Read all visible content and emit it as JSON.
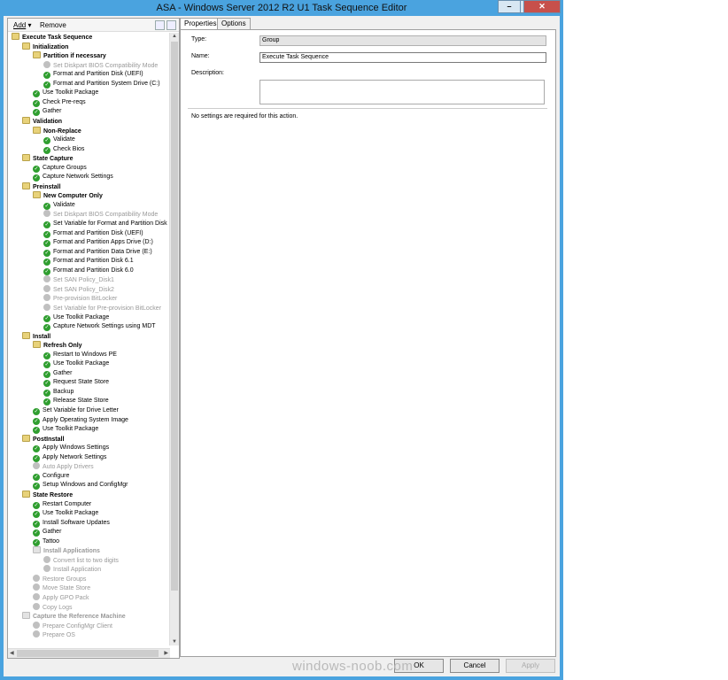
{
  "window": {
    "title": "ASA - Windows Server 2012 R2 U1 Task Sequence Editor",
    "minimize": "–",
    "maximize": "□",
    "close": "✕"
  },
  "toolbar": {
    "add": "Add",
    "remove": "Remove"
  },
  "tree": [
    {
      "label": "Execute Task Sequence",
      "lvl": 0,
      "icon": "folder",
      "bold": true
    },
    {
      "label": "Initialization",
      "lvl": 1,
      "icon": "folder",
      "bold": true
    },
    {
      "label": "Partition if necessary",
      "lvl": 2,
      "icon": "folder",
      "bold": true
    },
    {
      "label": "Set Diskpart BIOS Compatibility Mode",
      "lvl": 3,
      "icon": "disabled"
    },
    {
      "label": "Format and Partition Disk (UEFI)",
      "lvl": 3,
      "icon": "ok"
    },
    {
      "label": "Format and Partition System Drive (C:)",
      "lvl": 3,
      "icon": "ok"
    },
    {
      "label": "Use Toolkit Package",
      "lvl": 2,
      "icon": "ok"
    },
    {
      "label": "Check Pre-reqs",
      "lvl": 2,
      "icon": "ok"
    },
    {
      "label": "Gather",
      "lvl": 2,
      "icon": "ok"
    },
    {
      "label": "Validation",
      "lvl": 1,
      "icon": "folder",
      "bold": true
    },
    {
      "label": "Non-Replace",
      "lvl": 2,
      "icon": "folder",
      "bold": true
    },
    {
      "label": "Validate",
      "lvl": 3,
      "icon": "ok"
    },
    {
      "label": "Check Bios",
      "lvl": 3,
      "icon": "ok"
    },
    {
      "label": "State Capture",
      "lvl": 1,
      "icon": "folder",
      "bold": true
    },
    {
      "label": "Capture Groups",
      "lvl": 2,
      "icon": "ok"
    },
    {
      "label": "Capture Network Settings",
      "lvl": 2,
      "icon": "ok"
    },
    {
      "label": "Preinstall",
      "lvl": 1,
      "icon": "folder",
      "bold": true
    },
    {
      "label": "New Computer Only",
      "lvl": 2,
      "icon": "folder",
      "bold": true
    },
    {
      "label": "Validate",
      "lvl": 3,
      "icon": "ok"
    },
    {
      "label": "Set Diskpart BIOS Compatibility Mode",
      "lvl": 3,
      "icon": "disabled"
    },
    {
      "label": "Set Variable for Format and Partition Disk",
      "lvl": 3,
      "icon": "ok"
    },
    {
      "label": "Format and Partition Disk (UEFI)",
      "lvl": 3,
      "icon": "ok"
    },
    {
      "label": "Format and Partition Apps Drive (D:)",
      "lvl": 3,
      "icon": "ok"
    },
    {
      "label": "Format and Partition Data Drive (E:)",
      "lvl": 3,
      "icon": "ok"
    },
    {
      "label": "Format and Partition Disk 6.1",
      "lvl": 3,
      "icon": "ok"
    },
    {
      "label": "Format and Partition Disk 6.0",
      "lvl": 3,
      "icon": "ok"
    },
    {
      "label": "Set SAN Policy_Disk1",
      "lvl": 3,
      "icon": "disabled"
    },
    {
      "label": "Set SAN Policy_Disk2",
      "lvl": 3,
      "icon": "disabled"
    },
    {
      "label": "Pre-provision BitLocker",
      "lvl": 3,
      "icon": "disabled"
    },
    {
      "label": "Set Variable for Pre-provision BitLocker",
      "lvl": 3,
      "icon": "disabled"
    },
    {
      "label": "Use Toolkit Package",
      "lvl": 3,
      "icon": "ok"
    },
    {
      "label": "Capture Network Settings using MDT",
      "lvl": 3,
      "icon": "ok"
    },
    {
      "label": "Install",
      "lvl": 1,
      "icon": "folder",
      "bold": true
    },
    {
      "label": "Refresh Only",
      "lvl": 2,
      "icon": "folder",
      "bold": true
    },
    {
      "label": "Restart to Windows PE",
      "lvl": 3,
      "icon": "ok"
    },
    {
      "label": "Use Toolkit Package",
      "lvl": 3,
      "icon": "ok"
    },
    {
      "label": "Gather",
      "lvl": 3,
      "icon": "ok"
    },
    {
      "label": "Request State Store",
      "lvl": 3,
      "icon": "ok"
    },
    {
      "label": "Backup",
      "lvl": 3,
      "icon": "ok"
    },
    {
      "label": "Release State Store",
      "lvl": 3,
      "icon": "ok"
    },
    {
      "label": "Set Variable for Drive Letter",
      "lvl": 2,
      "icon": "ok"
    },
    {
      "label": "Apply Operating System Image",
      "lvl": 2,
      "icon": "ok"
    },
    {
      "label": "Use Toolkit Package",
      "lvl": 2,
      "icon": "ok"
    },
    {
      "label": "PostInstall",
      "lvl": 1,
      "icon": "folder",
      "bold": true
    },
    {
      "label": "Apply Windows Settings",
      "lvl": 2,
      "icon": "ok"
    },
    {
      "label": "Apply Network Settings",
      "lvl": 2,
      "icon": "ok"
    },
    {
      "label": "Auto Apply Drivers",
      "lvl": 2,
      "icon": "disabled"
    },
    {
      "label": "Configure",
      "lvl": 2,
      "icon": "ok"
    },
    {
      "label": "Setup Windows and ConfigMgr",
      "lvl": 2,
      "icon": "ok"
    },
    {
      "label": "State Restore",
      "lvl": 1,
      "icon": "folder",
      "bold": true
    },
    {
      "label": "Restart Computer",
      "lvl": 2,
      "icon": "ok"
    },
    {
      "label": "Use Toolkit Package",
      "lvl": 2,
      "icon": "ok"
    },
    {
      "label": "Install Software Updates",
      "lvl": 2,
      "icon": "ok"
    },
    {
      "label": "Gather",
      "lvl": 2,
      "icon": "ok"
    },
    {
      "label": "Tattoo",
      "lvl": 2,
      "icon": "ok"
    },
    {
      "label": "Install Applications",
      "lvl": 2,
      "icon": "folder-disabled",
      "bold": true
    },
    {
      "label": "Convert list to two digits",
      "lvl": 3,
      "icon": "disabled"
    },
    {
      "label": "Install Application",
      "lvl": 3,
      "icon": "disabled"
    },
    {
      "label": "Restore Groups",
      "lvl": 2,
      "icon": "disabled"
    },
    {
      "label": "Move State Store",
      "lvl": 2,
      "icon": "disabled"
    },
    {
      "label": "Apply GPO Pack",
      "lvl": 2,
      "icon": "disabled"
    },
    {
      "label": "Copy Logs",
      "lvl": 2,
      "icon": "disabled"
    },
    {
      "label": "Capture the Reference Machine",
      "lvl": 1,
      "icon": "folder-disabled",
      "bold": true
    },
    {
      "label": "Prepare ConfigMgr Client",
      "lvl": 2,
      "icon": "disabled"
    },
    {
      "label": "Prepare OS",
      "lvl": 2,
      "icon": "disabled"
    }
  ],
  "tabs": {
    "properties": "Properties",
    "options": "Options"
  },
  "props": {
    "type_label": "Type:",
    "type_value": "Group",
    "name_label": "Name:",
    "name_value": "Execute Task Sequence",
    "desc_label": "Description:",
    "note": "No settings are required  for this action."
  },
  "buttons": {
    "ok": "OK",
    "cancel": "Cancel",
    "apply": "Apply"
  },
  "watermark": "windows-noob.com"
}
